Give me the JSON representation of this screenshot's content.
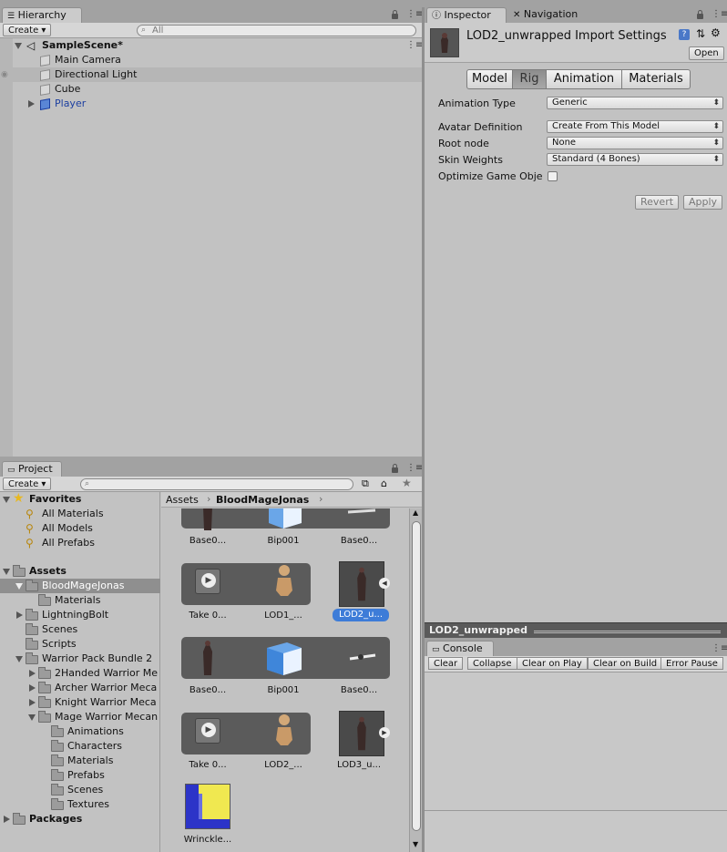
{
  "hierarchy": {
    "tab_label": "Hierarchy",
    "create_label": "Create",
    "search_placeholder": "All",
    "scene_name": "SampleScene*",
    "items": [
      "Main Camera",
      "Directional Light",
      "Cube",
      "Player"
    ]
  },
  "inspector": {
    "tab_inspector": "Inspector",
    "tab_navigation": "Navigation",
    "title": "LOD2_unwrapped Import Settings",
    "open_label": "Open",
    "tabs": [
      "Model",
      "Rig",
      "Animation",
      "Materials"
    ],
    "active_tab": "Rig",
    "fields": [
      {
        "label": "Animation Type",
        "value": "Generic"
      },
      {
        "label": "Avatar Definition",
        "value": "Create From This Model"
      },
      {
        "label": "Root node",
        "value": "None"
      },
      {
        "label": "Skin Weights",
        "value": "Standard (4 Bones)"
      },
      {
        "label": "Optimize Game Obje",
        "value": ""
      }
    ],
    "revert_label": "Revert",
    "apply_label": "Apply",
    "preview_label": "LOD2_unwrapped"
  },
  "project": {
    "tab_label": "Project",
    "create_label": "Create",
    "favorites_label": "Favorites",
    "favorites": [
      "All Materials",
      "All Models",
      "All Prefabs"
    ],
    "assets_label": "Assets",
    "tree": [
      "BloodMageJonas",
      "Materials",
      "LightningBolt",
      "Scenes",
      "Scripts",
      "Warrior Pack Bundle 2",
      "2Handed Warrior Me",
      "Archer Warrior Meca",
      "Knight Warrior Meca",
      "Mage Warrior Mecan",
      "Animations",
      "Characters",
      "Materials",
      "Prefabs",
      "Scenes",
      "Textures"
    ],
    "packages_label": "Packages",
    "breadcrumb": [
      "Assets",
      "BloodMageJonas"
    ],
    "grid_labels": [
      "Base0...",
      "Bip001",
      "Base0...",
      "Take 0...",
      "LOD1_...",
      "LOD2_u...",
      "Base0...",
      "Bip001",
      "Base0...",
      "Take 0...",
      "LOD2_...",
      "LOD3_u...",
      "Wrinckle..."
    ]
  },
  "console": {
    "tab_label": "Console",
    "buttons": [
      "Clear",
      "Collapse",
      "Clear on Play",
      "Clear on Build",
      "Error Pause"
    ]
  },
  "colors": {
    "selection": "#3d7cd8",
    "panel_bg": "#c2c2c2",
    "prefab_blue": "#1c3fa0"
  }
}
